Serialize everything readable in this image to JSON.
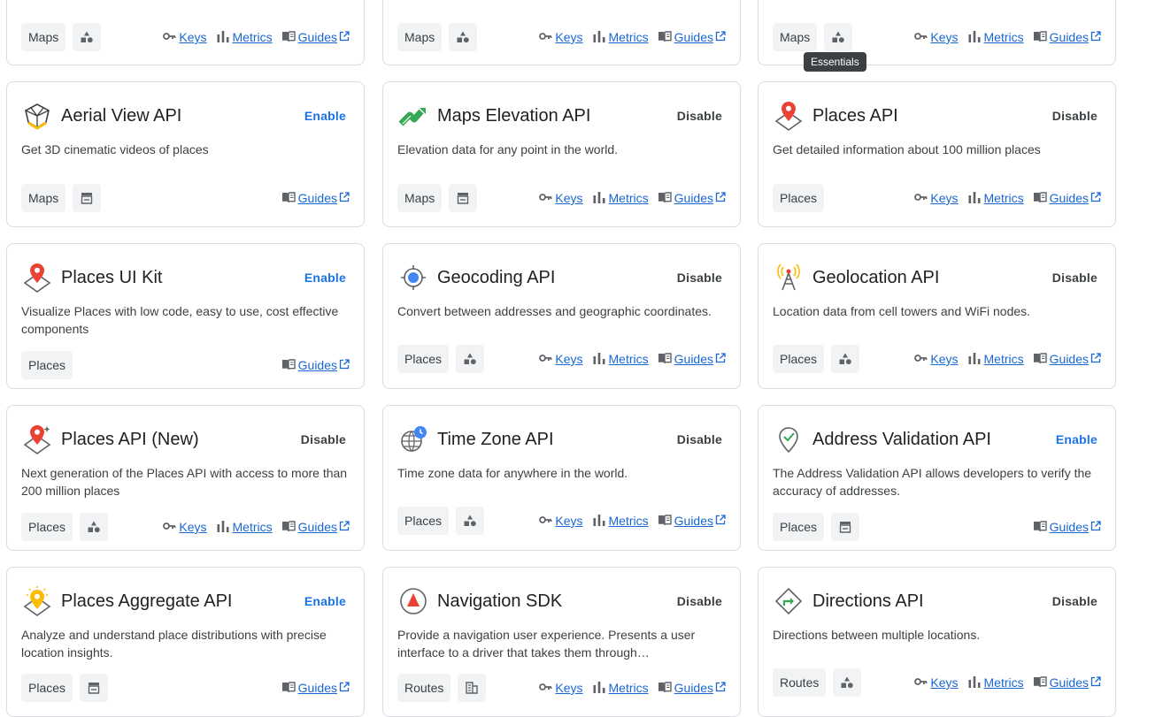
{
  "tooltip": "Essentials",
  "labels": {
    "keys": "Keys",
    "metrics": "Metrics",
    "guides": "Guides"
  },
  "cards": [
    {
      "title": "",
      "desc": "",
      "button": "",
      "tag": "Maps",
      "tier": "essentials",
      "links": [
        "keys",
        "metrics",
        "guides"
      ]
    },
    {
      "title": "",
      "desc": "",
      "button": "",
      "tag": "Maps",
      "tier": "essentials",
      "links": [
        "keys",
        "metrics",
        "guides"
      ]
    },
    {
      "title": "",
      "desc": "",
      "button": "",
      "tag": "Maps",
      "tier": "essentials",
      "links": [
        "keys",
        "metrics",
        "guides"
      ]
    },
    {
      "title": "Aerial View API",
      "desc": "Get 3D cinematic videos of places",
      "button": "Enable",
      "icon": "aerial-view-icon",
      "tag": "Maps",
      "tier": "store",
      "links": [
        "guides"
      ]
    },
    {
      "title": "Maps Elevation API",
      "desc": "Elevation data for any point in the world.",
      "button": "Disable",
      "icon": "elevation-icon",
      "tag": "Maps",
      "tier": "store",
      "links": [
        "keys",
        "metrics",
        "guides"
      ]
    },
    {
      "title": "Places API",
      "desc": "Get detailed information about 100 million places",
      "button": "Disable",
      "icon": "places-pin-icon",
      "tag": "Places",
      "tier": "none",
      "links": [
        "keys",
        "metrics",
        "guides"
      ]
    },
    {
      "title": "Places UI Kit",
      "desc": "Visualize Places with low code, easy to use, cost effective components",
      "button": "Enable",
      "icon": "places-pin-icon",
      "tag": "Places",
      "tier": "none",
      "links": [
        "guides"
      ]
    },
    {
      "title": "Geocoding API",
      "desc": "Convert between addresses and geographic coordinates.",
      "button": "Disable",
      "icon": "geocoding-icon",
      "tag": "Places",
      "tier": "essentials",
      "links": [
        "keys",
        "metrics",
        "guides"
      ]
    },
    {
      "title": "Geolocation API",
      "desc": "Location data from cell towers and WiFi nodes.",
      "button": "Disable",
      "icon": "geolocation-tower-icon",
      "tag": "Places",
      "tier": "essentials",
      "links": [
        "keys",
        "metrics",
        "guides"
      ]
    },
    {
      "title": "Places API (New)",
      "desc": "Next generation of the Places API with access to more than 200 million places",
      "button": "Disable",
      "icon": "places-new-icon",
      "tag": "Places",
      "tier": "essentials",
      "links": [
        "keys",
        "metrics",
        "guides"
      ]
    },
    {
      "title": "Time Zone API",
      "desc": "Time zone data for anywhere in the world.",
      "button": "Disable",
      "icon": "time-zone-icon",
      "tag": "Places",
      "tier": "essentials",
      "links": [
        "keys",
        "metrics",
        "guides"
      ]
    },
    {
      "title": "Address Validation API",
      "desc": "The Address Validation API allows developers to verify the accuracy of addresses.",
      "button": "Enable",
      "icon": "address-check-icon",
      "tag": "Places",
      "tier": "store",
      "links": [
        "guides"
      ]
    },
    {
      "title": "Places Aggregate API",
      "desc": "Analyze and understand place distributions with precise location insights.",
      "button": "Enable",
      "icon": "places-aggregate-icon",
      "tag": "Places",
      "tier": "store",
      "links": [
        "guides"
      ]
    },
    {
      "title": "Navigation SDK",
      "desc": "Provide a navigation user experience. Presents a user interface to a driver that takes them through…",
      "button": "Disable",
      "icon": "navigation-icon",
      "tag": "Routes",
      "tier": "enterprise",
      "links": [
        "keys",
        "metrics",
        "guides"
      ]
    },
    {
      "title": "Directions API",
      "desc": "Directions between multiple locations.",
      "button": "Disable",
      "icon": "directions-icon",
      "tag": "Routes",
      "tier": "essentials",
      "links": [
        "keys",
        "metrics",
        "guides"
      ]
    }
  ]
}
